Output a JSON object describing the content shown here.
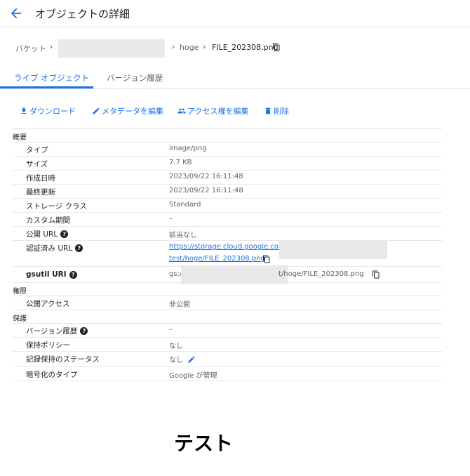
{
  "header": {
    "title": "オブジェクトの詳細"
  },
  "breadcrumb": {
    "bucket_label": "バケット",
    "folder": "hoge",
    "file": "FILE_202308.png"
  },
  "tabs": [
    {
      "label": "ライブ オブジェクト",
      "active": true
    },
    {
      "label": "バージョン履歴",
      "active": false
    }
  ],
  "actions": {
    "download": "ダウンロード",
    "edit_metadata": "メタデータを編集",
    "edit_access": "アクセス権を編集",
    "delete": "削除"
  },
  "sections": {
    "overview": "概要",
    "permissions": "権限",
    "protection": "保護"
  },
  "overview": {
    "type_label": "タイプ",
    "type_value": "image/png",
    "size_label": "サイズ",
    "size_value": "7.7 KB",
    "created_label": "作成日時",
    "created_value": "2023/09/22 16:11:48",
    "updated_label": "最終更新",
    "updated_value": "2023/09/22 16:11:48",
    "storage_label": "ストレージ クラス",
    "storage_value": "Standard",
    "custom_label": "カスタム期間",
    "custom_value": "–",
    "public_url_label": "公開 URL",
    "public_url_value": "該当なし",
    "auth_url_label": "認証済み URL",
    "auth_url_line1": "https://storage.cloud.google.com/",
    "auth_url_line2": "test/hoge/FILE_202308.png",
    "gsutil_label": "gsutil URI",
    "gsutil_prefix": "gs:/",
    "gsutil_suffix": "t/hoge/FILE_202308.png"
  },
  "permissions": {
    "public_access_label": "公開アクセス",
    "public_access_value": "非公開"
  },
  "protection": {
    "version_label": "バージョン履歴",
    "version_value": "–",
    "retention_label": "保持ポリシー",
    "retention_value": "なし",
    "hold_label": "記録保持のステータス",
    "hold_value": "なし",
    "encryption_label": "暗号化のタイプ",
    "encryption_value": "Google が管理"
  },
  "footer": {
    "text": "テスト"
  },
  "colors": {
    "accent": "#1a73e8",
    "text": "#202124",
    "muted": "#5f6368"
  }
}
